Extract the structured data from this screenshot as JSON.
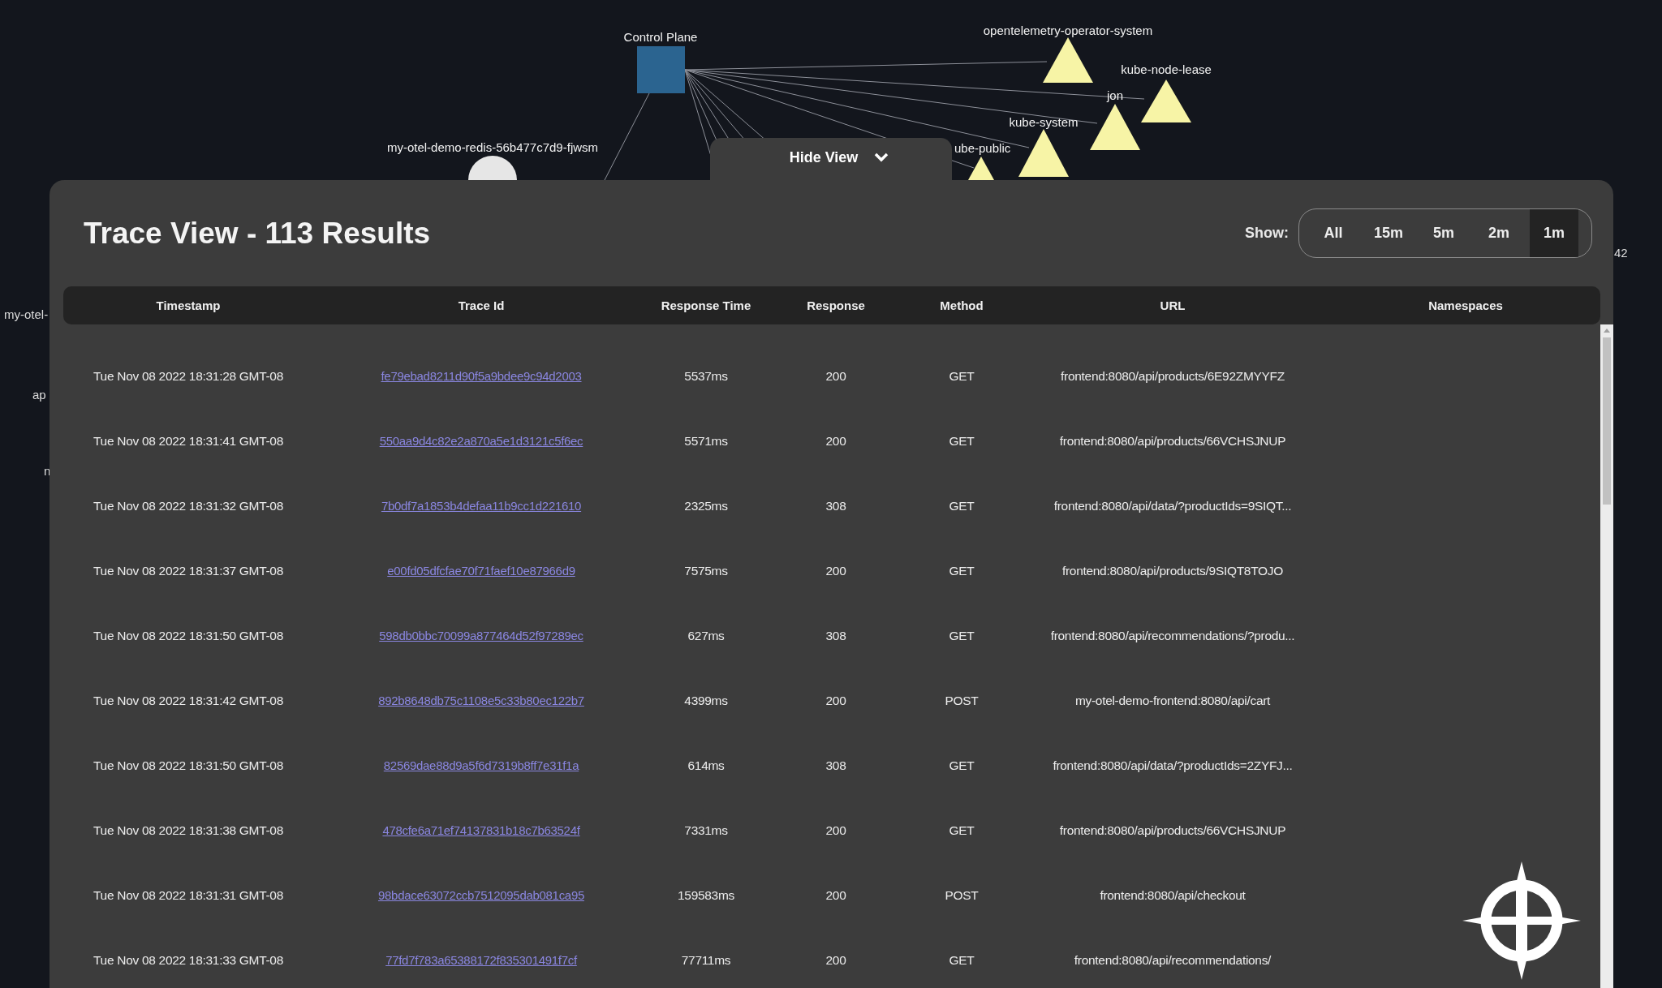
{
  "graph": {
    "nodes": [
      {
        "kind": "square",
        "label": "Control Plane"
      },
      {
        "kind": "triangle",
        "label": "opentelemetry-operator-system"
      },
      {
        "kind": "triangle",
        "label": "kube-node-lease"
      },
      {
        "kind": "triangle",
        "label": "jon"
      },
      {
        "kind": "triangle",
        "label": "kube-system"
      },
      {
        "kind": "triangle",
        "label": "ube-public"
      },
      {
        "kind": "circle",
        "label": "my-otel-demo-redis-56b477c7d9-fjwsm"
      }
    ],
    "cut_labels": [
      "my-otel-",
      "ap",
      "n",
      "42"
    ]
  },
  "toggle": {
    "label": "Hide View"
  },
  "panel": {
    "title": "Trace View - 113 Results",
    "show_label": "Show:",
    "ranges": [
      {
        "label": "All",
        "selected": false
      },
      {
        "label": "15m",
        "selected": false
      },
      {
        "label": "5m",
        "selected": false
      },
      {
        "label": "2m",
        "selected": false
      },
      {
        "label": "1m",
        "selected": true
      }
    ],
    "table": {
      "columns": [
        "Timestamp",
        "Trace Id",
        "Response Time",
        "Response",
        "Method",
        "URL",
        "Namespaces"
      ],
      "rows": [
        {
          "timestamp": "Tue Nov 08 2022 18:31:28 GMT-08",
          "trace_id": "fe79ebad8211d90f5a9bdee9c94d2003",
          "response_time": "5537ms",
          "response": "200",
          "method": "GET",
          "url": "frontend:8080/api/products/6E92ZMYYFZ"
        },
        {
          "timestamp": "Tue Nov 08 2022 18:31:41 GMT-08",
          "trace_id": "550aa9d4c82e2a870a5e1d3121c5f6ec",
          "response_time": "5571ms",
          "response": "200",
          "method": "GET",
          "url": "frontend:8080/api/products/66VCHSJNUP"
        },
        {
          "timestamp": "Tue Nov 08 2022 18:31:32 GMT-08",
          "trace_id": "7b0df7a1853b4defaa11b9cc1d221610",
          "response_time": "2325ms",
          "response": "308",
          "method": "GET",
          "url": "frontend:8080/api/data/?productIds=9SIQT..."
        },
        {
          "timestamp": "Tue Nov 08 2022 18:31:37 GMT-08",
          "trace_id": "e00fd05dfcfae70f71faef10e87966d9",
          "response_time": "7575ms",
          "response": "200",
          "method": "GET",
          "url": "frontend:8080/api/products/9SIQT8TOJO"
        },
        {
          "timestamp": "Tue Nov 08 2022 18:31:50 GMT-08",
          "trace_id": "598db0bbc70099a877464d52f97289ec",
          "response_time": "627ms",
          "response": "308",
          "method": "GET",
          "url": "frontend:8080/api/recommendations/?produ..."
        },
        {
          "timestamp": "Tue Nov 08 2022 18:31:42 GMT-08",
          "trace_id": "892b8648db75c1108e5c33b80ec122b7",
          "response_time": "4399ms",
          "response": "200",
          "method": "POST",
          "url": "my-otel-demo-frontend:8080/api/cart"
        },
        {
          "timestamp": "Tue Nov 08 2022 18:31:50 GMT-08",
          "trace_id": "82569dae88d9a5f6d7319b8ff7e31f1a",
          "response_time": "614ms",
          "response": "308",
          "method": "GET",
          "url": "frontend:8080/api/data/?productIds=2ZYFJ..."
        },
        {
          "timestamp": "Tue Nov 08 2022 18:31:38 GMT-08",
          "trace_id": "478cfe6a71ef74137831b18c7b63524f",
          "response_time": "7331ms",
          "response": "200",
          "method": "GET",
          "url": "frontend:8080/api/products/66VCHSJNUP"
        },
        {
          "timestamp": "Tue Nov 08 2022 18:31:31 GMT-08",
          "trace_id": "98bdace63072ccb7512095dab081ca95",
          "response_time": "159583ms",
          "response": "200",
          "method": "POST",
          "url": "frontend:8080/api/checkout"
        },
        {
          "timestamp": "Tue Nov 08 2022 18:31:33 GMT-08",
          "trace_id": "77fd7f783a65388172f835301491f7cf",
          "response_time": "77711ms",
          "response": "200",
          "method": "GET",
          "url": "frontend:8080/api/recommendations/"
        }
      ]
    }
  }
}
